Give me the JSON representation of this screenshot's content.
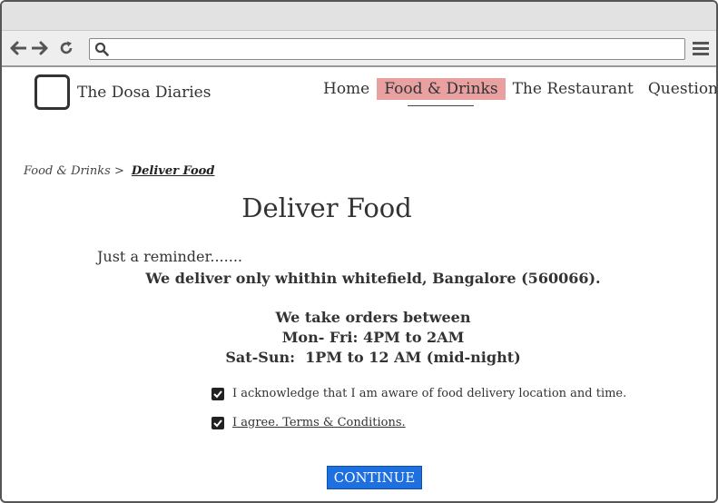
{
  "header": {
    "site_title": "The Dosa Diaries",
    "nav": [
      {
        "label": "Home"
      },
      {
        "label": "Food & Drinks",
        "active": true
      },
      {
        "label": "The Restaurant"
      },
      {
        "label": "Questions"
      }
    ]
  },
  "breadcrumb": {
    "parent": "Food & Drinks >",
    "current": "Deliver Food"
  },
  "main": {
    "title": "Deliver Food",
    "reminder": "Just a reminder.......",
    "delivery_area": "We deliver only whithin whitefield, Bangalore (560066).",
    "hours_heading": "We take orders between",
    "hours_weekday": "Mon- Fri: 4PM to 2AM",
    "hours_weekend": "Sat-Sun:  1PM to 12 AM (mid-night)"
  },
  "checkboxes": [
    {
      "label": "I acknowledge that I am aware of food delivery location and time.",
      "checked": true
    },
    {
      "label": "I agree. Terms & Conditions.",
      "checked": true
    }
  ],
  "continue_label": "CONTINUE",
  "colors": {
    "accent": "#1e6fe0",
    "nav_active_bg": "#e8a0a0"
  },
  "icons": [
    "back-arrow-icon",
    "forward-arrow-icon",
    "reload-icon",
    "search-icon",
    "hamburger-menu-icon",
    "checkmark-icon"
  ]
}
